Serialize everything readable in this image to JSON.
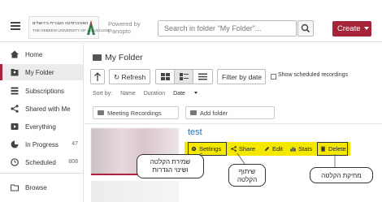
{
  "header": {
    "logo_text_he": "האוניברסיטה העברית בירושלים",
    "logo_text_en": "THE HEBREW UNIVERSITY OF JERUSALEM",
    "powered_by": "Powered by",
    "powered_brand": "Panopto",
    "search_placeholder": "Search in folder \"My Folder\"...",
    "create_label": "Create",
    "brand_color": "#a5243a"
  },
  "sidebar": {
    "items": [
      {
        "label": "Home",
        "icon": "home-icon"
      },
      {
        "label": "My Folder",
        "icon": "user-folder-icon",
        "active": true
      },
      {
        "label": "Subscriptions",
        "icon": "subscriptions-icon"
      },
      {
        "label": "Shared with Me",
        "icon": "share-icon"
      },
      {
        "label": "Everything",
        "icon": "video-icon"
      },
      {
        "label": "In Progress",
        "icon": "progress-icon",
        "count": "47"
      },
      {
        "label": "Scheduled",
        "icon": "clock-icon",
        "count": "808"
      },
      {
        "label": "Browse",
        "icon": "folder-icon"
      }
    ]
  },
  "main": {
    "folder_title": "My Folder",
    "refresh_label": "Refresh",
    "filter_label": "Filter by date",
    "show_scheduled_label": "Show scheduled recordings",
    "sort": {
      "sort_by": "Sort by:",
      "name": "Name",
      "duration": "Duration",
      "date": "Date"
    },
    "meeting_recordings_label": "Meeting Recordings",
    "add_folder_label": "Add folder",
    "recording": {
      "title": "test",
      "actions": [
        "Settings",
        "Share",
        "Edit",
        "Stats",
        "Delete"
      ],
      "highlight_color": "#f5e800"
    }
  },
  "callouts": {
    "settings": [
      "שמירת הקלטה",
      "ושינוי הגדרות"
    ],
    "share": [
      "שיתוף",
      "הקלטה"
    ],
    "delete": "מחיקת הקלטה"
  }
}
